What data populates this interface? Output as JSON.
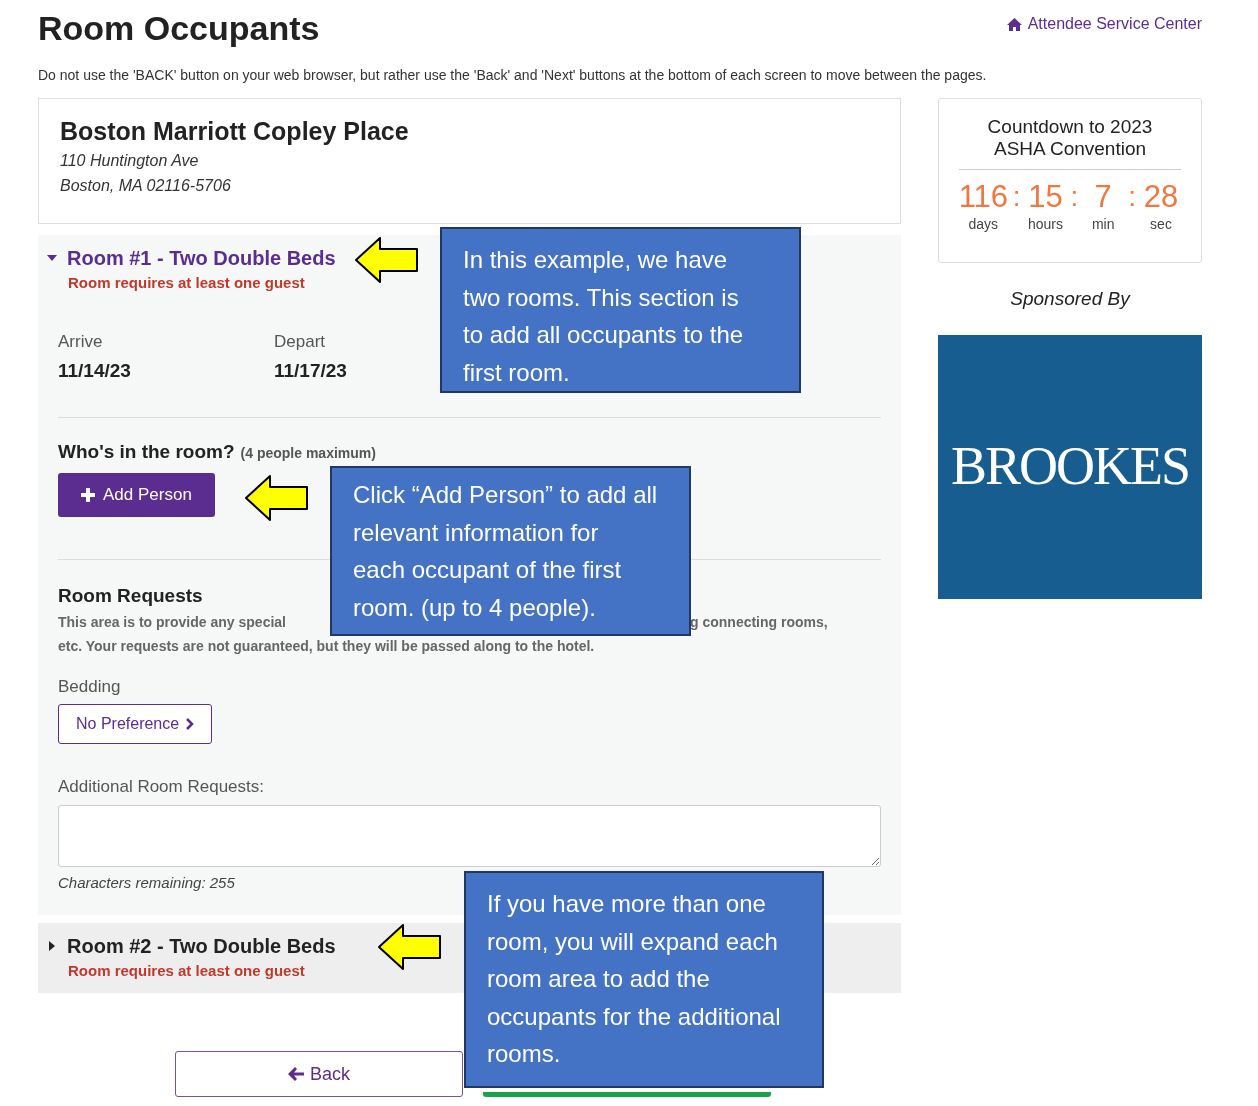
{
  "header": {
    "title": "Room Occupants",
    "service_link": "Attendee Service Center"
  },
  "notice": "Do not use the 'BACK' button on your web browser, but rather use the 'Back' and 'Next' buttons at the bottom of each screen to move between the pages.",
  "hotel": {
    "name": "Boston Marriott Copley Place",
    "address_lines": [
      "110 Huntington Ave",
      "Boston, MA 02116-5706"
    ]
  },
  "rooms": [
    {
      "title": "Room #1 - Two Double Beds",
      "warning": "Room requires at least one guest",
      "expanded": true,
      "dates": [
        {
          "label": "Arrive",
          "value": "11/14/23"
        },
        {
          "label": "Depart",
          "value": "11/17/23"
        }
      ],
      "occupants_heading": "Who's in the room?",
      "occupants_note": "(4 people maximum)",
      "add_button": "Add Person",
      "requests_heading": "Room Requests",
      "requests_text_visible_parts": [
        "This area is to provide any special",
        "g connecting rooms,"
      ],
      "requests_text_line2": "etc. Your requests are not guaranteed, but they will be passed along to the hotel.",
      "bedding_label": "Bedding",
      "bedding_value": "No Preference",
      "additional_label": "Additional Room Requests:",
      "characters_remaining": "Characters remaining: 255"
    },
    {
      "title": "Room #2 - Two Double Beds",
      "warning": "Room requires at least one guest",
      "expanded": false
    }
  ],
  "nav": {
    "back": "Back"
  },
  "countdown": {
    "title_lines": [
      "Countdown to 2023",
      "ASHA Convention"
    ],
    "separator": ":",
    "units": [
      {
        "value": "116",
        "label": "days"
      },
      {
        "value": "15",
        "label": "hours"
      },
      {
        "value": "7",
        "label": "min"
      },
      {
        "value": "28",
        "label": "sec"
      }
    ]
  },
  "sponsor": {
    "heading": "Sponsored By",
    "logo_text": "BROOKES"
  },
  "callouts": [
    {
      "lines": [
        "In this example, we have",
        "two rooms. This section is",
        "to add all occupants to the",
        "first room."
      ]
    },
    {
      "lines": [
        "Click “Add Person” to add all",
        "relevant information for",
        "each occupant of the first",
        "room. (up to 4 people)."
      ]
    },
    {
      "lines": [
        "If you have more than one",
        "room, you will expand each",
        "room area to add the",
        "occupants for the additional",
        "rooms."
      ]
    }
  ]
}
